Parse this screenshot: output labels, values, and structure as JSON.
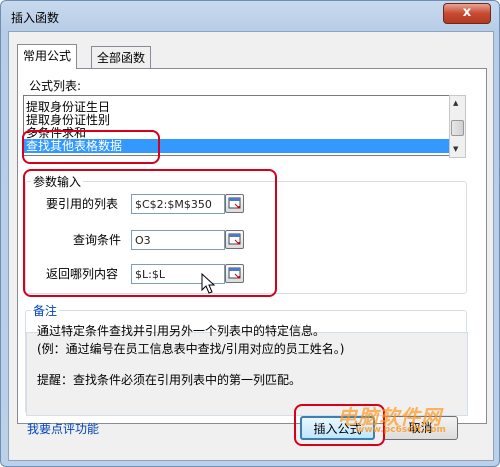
{
  "window": {
    "title": "插入函数",
    "close_label": "x"
  },
  "tabs": [
    {
      "label": "常用公式",
      "active": true
    },
    {
      "label": "全部函数",
      "active": false
    }
  ],
  "formula_list": {
    "label": "公式列表:",
    "items": [
      "提取身份证生日",
      "提取身份证性别",
      "多条件求和",
      "查找其他表格数据"
    ],
    "selected_index": 3
  },
  "params": {
    "label": "参数输入",
    "fields": [
      {
        "label": "要引用的列表",
        "value": "$C$2:$M$350"
      },
      {
        "label": "查询条件",
        "value": "O3"
      },
      {
        "label": "返回哪列内容",
        "value": "$L:$L"
      }
    ]
  },
  "notes": {
    "label": "备注",
    "line1": "通过特定条件查找并引用另外一个列表中的特定信息。",
    "line2": "(例：通过编号在员工信息表中查找/引用对应的员工姓名。)",
    "line3": "提醒：查找条件必须在引用列表中的第一列匹配。"
  },
  "footer": {
    "feedback_link": "我要点评功能",
    "insert_label": "插入公式",
    "cancel_label": "取消"
  },
  "watermark": {
    "text": "电脑软件网",
    "url": "www.pc6soft.com"
  },
  "colors": {
    "highlight": "#d7001a",
    "selection": "#3399ff",
    "link": "#0044bb"
  }
}
